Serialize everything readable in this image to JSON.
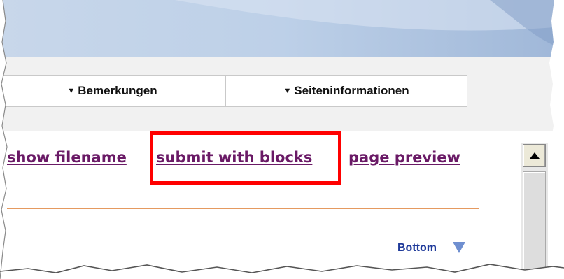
{
  "tabs": [
    {
      "label": "Bemerkungen",
      "icon": "triangle-down-icon"
    },
    {
      "label": "Seiteninformationen",
      "icon": "triangle-down-icon"
    }
  ],
  "links": {
    "show_filename": "show filename",
    "submit_with_blocks": "submit with blocks",
    "page_preview": "page preview"
  },
  "bottom_link": "Bottom",
  "colors": {
    "link_visited": "#6a1a66",
    "highlight": "#ff0000",
    "rule": "#e59a60",
    "bottom_link": "#1f3a9a"
  }
}
